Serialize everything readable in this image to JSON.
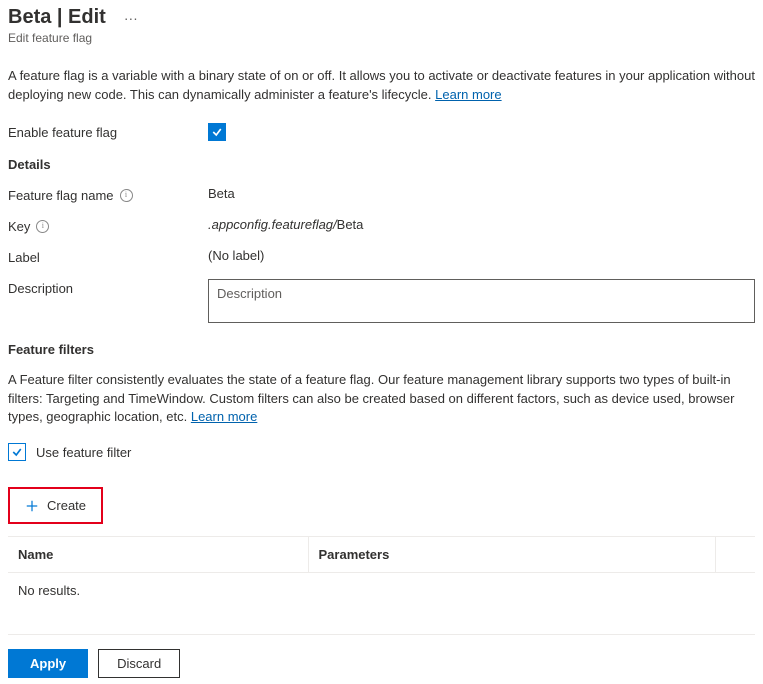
{
  "header": {
    "title": "Beta | Edit",
    "subtitle": "Edit feature flag"
  },
  "intro": {
    "text": "A feature flag is a variable with a binary state of on or off. It allows you to activate or deactivate features in your application without deploying new code. This can dynamically administer a feature's lifecycle. ",
    "learn_more": "Learn more"
  },
  "enable": {
    "label": "Enable feature flag",
    "checked": true
  },
  "details": {
    "heading": "Details",
    "name_label": "Feature flag name",
    "name_value": "Beta",
    "key_label": "Key",
    "key_prefix": ".appconfig.featureflag/",
    "key_value": "Beta",
    "label_label": "Label",
    "label_value": "(No label)",
    "description_label": "Description",
    "description_placeholder": "Description",
    "description_value": ""
  },
  "filters": {
    "heading": "Feature filters",
    "desc": "A Feature filter consistently evaluates the state of a feature flag. Our feature management library supports two types of built-in filters: Targeting and TimeWindow. Custom filters can also be created based on different factors, such as device used, browser types, geographic location, etc. ",
    "learn_more": "Learn more",
    "use_label": "Use feature filter",
    "use_checked": true,
    "create_label": "Create",
    "table": {
      "col_name": "Name",
      "col_params": "Parameters",
      "empty": "No results."
    }
  },
  "footer": {
    "apply": "Apply",
    "discard": "Discard"
  }
}
